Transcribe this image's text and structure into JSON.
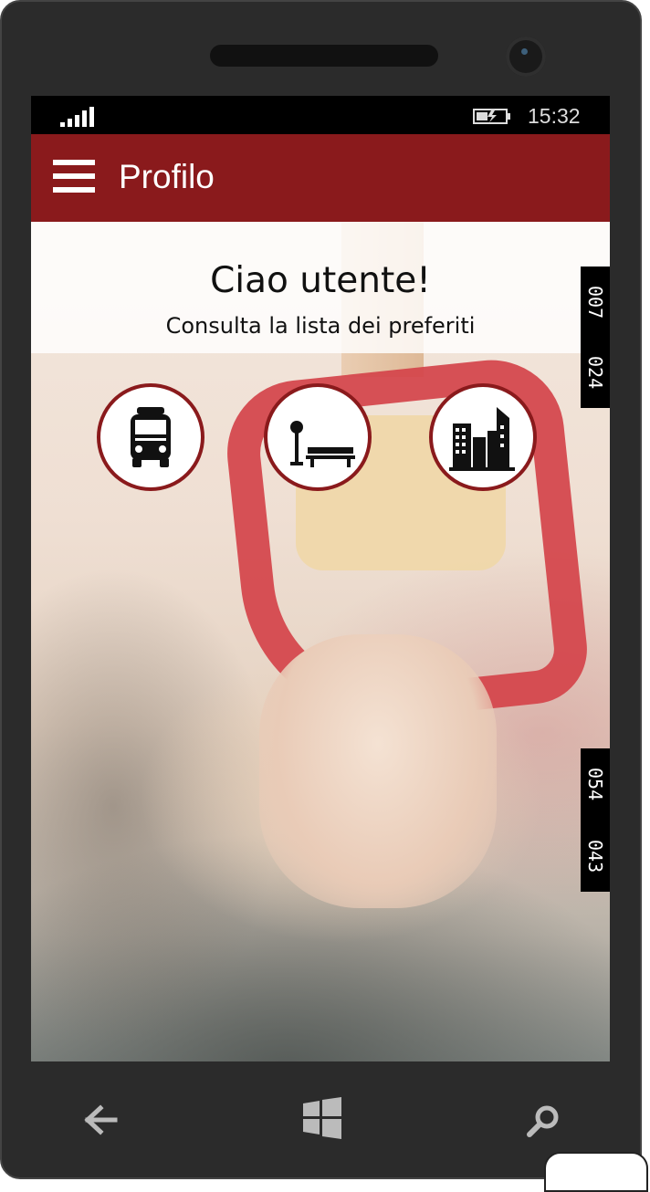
{
  "statusbar": {
    "time": "15:32",
    "signal_icon": "signal-bars-icon",
    "battery_icon": "battery-charging-icon"
  },
  "appbar": {
    "title": "Profilo",
    "menu_icon": "hamburger-menu-icon",
    "color": "#8a1a1c"
  },
  "header": {
    "greeting": "Ciao utente!",
    "subtitle": "Consulta la lista dei preferiti"
  },
  "favorites": [
    {
      "name": "bus",
      "icon": "bus-icon"
    },
    {
      "name": "bus-stop",
      "icon": "bus-stop-bench-icon"
    },
    {
      "name": "city",
      "icon": "buildings-icon"
    }
  ],
  "tickers": [
    {
      "codes": [
        "007",
        "024"
      ]
    },
    {
      "codes": [
        "054",
        "043"
      ]
    }
  ],
  "navbar": {
    "back_icon": "back-arrow-icon",
    "home_icon": "windows-logo-icon",
    "search_icon": "search-icon"
  }
}
